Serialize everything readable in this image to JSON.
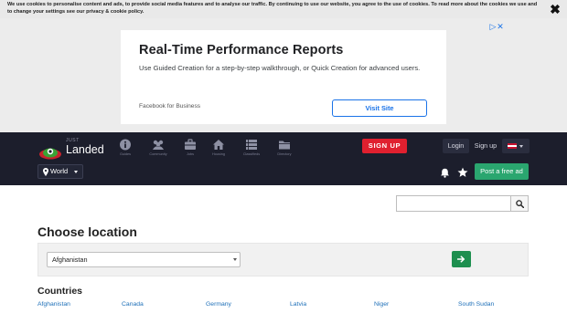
{
  "cookie_bar": {
    "text": "We use cookies to personalise content and ads, to provide social media features and to analyse our traffic. By continuing to use our website, you agree to the use of cookies. To read more about the cookies we use and to change your settings see our privacy & cookie policy.",
    "close_label": "✖"
  },
  "ad": {
    "title": "Real-Time Performance Reports",
    "description": "Use Guided Creation for a step-by-step walkthrough, or Quick Creation for advanced users.",
    "source": "Facebook for Business",
    "button_label": "Visit Site",
    "marker": "▷",
    "marker_close": "✕",
    "marker_color": "#1a73e8"
  },
  "logo": {
    "small_text": "JUST",
    "big_text": "Landed"
  },
  "nav": {
    "items": [
      {
        "label": "Guides",
        "icon": "info-icon"
      },
      {
        "label": "Community",
        "icon": "community-icon"
      },
      {
        "label": "Jobs",
        "icon": "briefcase-icon"
      },
      {
        "label": "Housing",
        "icon": "house-icon"
      },
      {
        "label": "Classifieds",
        "icon": "classifieds-icon"
      },
      {
        "label": "Directory",
        "icon": "folder-icon"
      }
    ],
    "signup_button": "SIGN UP",
    "login": "Login",
    "signup_link": "Sign up",
    "world_button": "World",
    "post_ad": "Post a free ad"
  },
  "search": {
    "placeholder": "",
    "value": ""
  },
  "choose_location": {
    "title": "Choose location",
    "selected": "Afghanistan"
  },
  "countries": {
    "title": "Countries",
    "visible": [
      "Afghanistan",
      "Canada",
      "Germany",
      "Latvia",
      "Niger",
      "South Sudan"
    ]
  },
  "colors": {
    "navbar": "#1c1e2c",
    "signup_red": "#e0202f",
    "post_ad_green": "#2aa66f",
    "go_button_green": "#1e8f4f",
    "link_blue": "#1d6fb8"
  }
}
